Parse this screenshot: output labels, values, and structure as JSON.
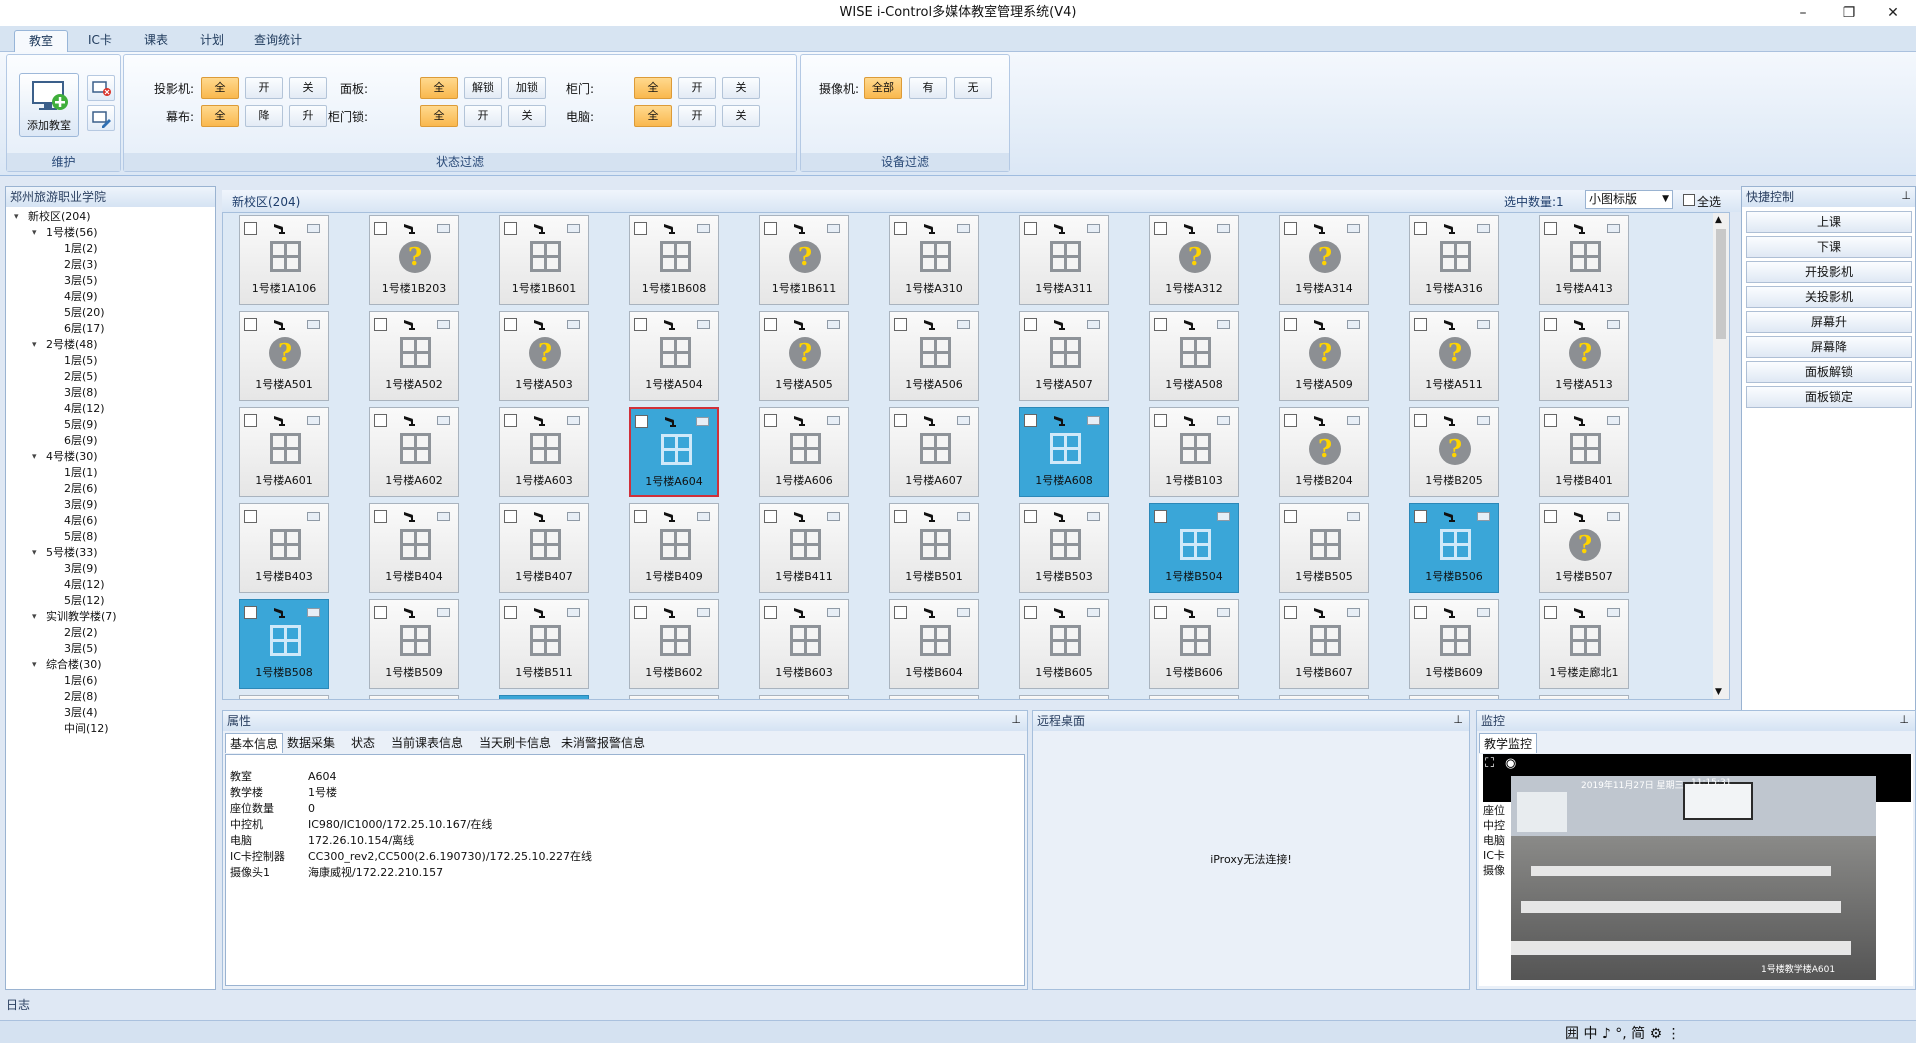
{
  "window": {
    "title": "WISE i-Control多媒体教室管理系统(V4)",
    "minimize_icon": "–",
    "restore_icon": "❐",
    "close_icon": "✕"
  },
  "menu": {
    "tabs": [
      "教室",
      "IC卡",
      "课表",
      "计划",
      "查询统计"
    ],
    "active": "教室"
  },
  "ribbon": {
    "maintain": {
      "label": "维护",
      "add_room": "添加教室"
    },
    "status_filter": {
      "label": "状态过滤",
      "projector": {
        "label": "投影机:",
        "options": [
          "全",
          "开",
          "关"
        ]
      },
      "screen": {
        "label": "幕布:",
        "options": [
          "全",
          "降",
          "升"
        ]
      },
      "panel": {
        "label": "面板:",
        "options": [
          "全",
          "解锁",
          "加锁"
        ]
      },
      "cabinet_lock": {
        "label": "柜门锁:",
        "options": [
          "全",
          "开",
          "关"
        ]
      },
      "door": {
        "label": "柜门:",
        "options": [
          "全",
          "开",
          "关"
        ]
      },
      "pc": {
        "label": "电脑:",
        "options": [
          "全",
          "开",
          "关"
        ]
      }
    },
    "device_filter": {
      "label": "设备过滤",
      "camera": {
        "label": "摄像机:",
        "options": [
          "全部",
          "有",
          "无"
        ]
      }
    }
  },
  "tree": {
    "title": "郑州旅游职业学院",
    "nodes": [
      {
        "t": "新校区(204)",
        "l": 0,
        "e": true
      },
      {
        "t": "1号楼(56)",
        "l": 1,
        "e": true
      },
      {
        "t": "1层(2)",
        "l": 2
      },
      {
        "t": "2层(3)",
        "l": 2
      },
      {
        "t": "3层(5)",
        "l": 2
      },
      {
        "t": "4层(9)",
        "l": 2
      },
      {
        "t": "5层(20)",
        "l": 2
      },
      {
        "t": "6层(17)",
        "l": 2
      },
      {
        "t": "2号楼(48)",
        "l": 1,
        "e": true
      },
      {
        "t": "1层(5)",
        "l": 2
      },
      {
        "t": "2层(5)",
        "l": 2
      },
      {
        "t": "3层(8)",
        "l": 2
      },
      {
        "t": "4层(12)",
        "l": 2
      },
      {
        "t": "5层(9)",
        "l": 2
      },
      {
        "t": "6层(9)",
        "l": 2
      },
      {
        "t": "4号楼(30)",
        "l": 1,
        "e": true
      },
      {
        "t": "1层(1)",
        "l": 2
      },
      {
        "t": "2层(6)",
        "l": 2
      },
      {
        "t": "3层(9)",
        "l": 2
      },
      {
        "t": "4层(6)",
        "l": 2
      },
      {
        "t": "5层(8)",
        "l": 2
      },
      {
        "t": "5号楼(33)",
        "l": 1,
        "e": true
      },
      {
        "t": "3层(9)",
        "l": 2
      },
      {
        "t": "4层(12)",
        "l": 2
      },
      {
        "t": "5层(12)",
        "l": 2
      },
      {
        "t": "实训教学楼(7)",
        "l": 1,
        "e": true
      },
      {
        "t": "2层(2)",
        "l": 2
      },
      {
        "t": "3层(5)",
        "l": 2
      },
      {
        "t": "综合楼(30)",
        "l": 1,
        "e": true
      },
      {
        "t": "1层(6)",
        "l": 2
      },
      {
        "t": "2层(8)",
        "l": 2
      },
      {
        "t": "3层(4)",
        "l": 2
      },
      {
        "t": "中间(12)",
        "l": 2
      }
    ]
  },
  "center": {
    "title": "新校区(204)",
    "selected_count": "选中数量:1",
    "view_mode": "小图标版",
    "select_all": "全选"
  },
  "rooms": [
    {
      "n": "1号楼1A106",
      "cam": true,
      "q": false
    },
    {
      "n": "1号楼1B203",
      "cam": true,
      "q": true
    },
    {
      "n": "1号楼1B601",
      "cam": true,
      "q": false
    },
    {
      "n": "1号楼1B608",
      "cam": true,
      "q": false
    },
    {
      "n": "1号楼1B611",
      "cam": true,
      "q": true
    },
    {
      "n": "1号楼A310",
      "cam": true,
      "q": false
    },
    {
      "n": "1号楼A311",
      "cam": true,
      "q": false
    },
    {
      "n": "1号楼A312",
      "cam": true,
      "q": true
    },
    {
      "n": "1号楼A314",
      "cam": true,
      "q": true
    },
    {
      "n": "1号楼A316",
      "cam": true,
      "q": false
    },
    {
      "n": "1号楼A413",
      "cam": true,
      "q": false
    },
    {
      "n": "1号楼A501",
      "cam": true,
      "q": true
    },
    {
      "n": "1号楼A502",
      "cam": true,
      "q": false
    },
    {
      "n": "1号楼A503",
      "cam": true,
      "q": true
    },
    {
      "n": "1号楼A504",
      "cam": true,
      "q": false
    },
    {
      "n": "1号楼A505",
      "cam": true,
      "q": true
    },
    {
      "n": "1号楼A506",
      "cam": true,
      "q": false
    },
    {
      "n": "1号楼A507",
      "cam": true,
      "q": false
    },
    {
      "n": "1号楼A508",
      "cam": true,
      "q": false
    },
    {
      "n": "1号楼A509",
      "cam": true,
      "q": true
    },
    {
      "n": "1号楼A511",
      "cam": true,
      "q": true
    },
    {
      "n": "1号楼A513",
      "cam": true,
      "q": true
    },
    {
      "n": "1号楼A601",
      "cam": true,
      "q": false
    },
    {
      "n": "1号楼A602",
      "cam": true,
      "q": false
    },
    {
      "n": "1号楼A603",
      "cam": true,
      "q": false
    },
    {
      "n": "1号楼A604",
      "cam": true,
      "q": false,
      "sel": true,
      "cur": true
    },
    {
      "n": "1号楼A606",
      "cam": true,
      "q": false
    },
    {
      "n": "1号楼A607",
      "cam": true,
      "q": false
    },
    {
      "n": "1号楼A608",
      "cam": true,
      "q": false,
      "sel": true
    },
    {
      "n": "1号楼B103",
      "cam": true,
      "q": false
    },
    {
      "n": "1号楼B204",
      "cam": true,
      "q": true
    },
    {
      "n": "1号楼B205",
      "cam": true,
      "q": true
    },
    {
      "n": "1号楼B401",
      "cam": true,
      "q": false
    },
    {
      "n": "1号楼B403",
      "cam": false,
      "q": false
    },
    {
      "n": "1号楼B404",
      "cam": true,
      "q": false
    },
    {
      "n": "1号楼B407",
      "cam": true,
      "q": false
    },
    {
      "n": "1号楼B409",
      "cam": true,
      "q": false
    },
    {
      "n": "1号楼B411",
      "cam": true,
      "q": false
    },
    {
      "n": "1号楼B501",
      "cam": true,
      "q": false
    },
    {
      "n": "1号楼B503",
      "cam": true,
      "q": false
    },
    {
      "n": "1号楼B504",
      "cam": false,
      "q": false,
      "sel": true
    },
    {
      "n": "1号楼B505",
      "cam": false,
      "q": false
    },
    {
      "n": "1号楼B506",
      "cam": true,
      "q": false,
      "sel": true
    },
    {
      "n": "1号楼B507",
      "cam": true,
      "q": true
    },
    {
      "n": "1号楼B508",
      "cam": true,
      "q": false,
      "sel": true
    },
    {
      "n": "1号楼B509",
      "cam": true,
      "q": false
    },
    {
      "n": "1号楼B511",
      "cam": true,
      "q": false
    },
    {
      "n": "1号楼B602",
      "cam": true,
      "q": false
    },
    {
      "n": "1号楼B603",
      "cam": true,
      "q": false
    },
    {
      "n": "1号楼B604",
      "cam": true,
      "q": false
    },
    {
      "n": "1号楼B605",
      "cam": true,
      "q": false
    },
    {
      "n": "1号楼B606",
      "cam": true,
      "q": false
    },
    {
      "n": "1号楼B607",
      "cam": true,
      "q": false
    },
    {
      "n": "1号楼B609",
      "cam": true,
      "q": false
    },
    {
      "n": "1号楼走廊北1",
      "cam": true,
      "q": false
    }
  ],
  "quick_control": {
    "title": "快捷控制",
    "buttons": [
      "上课",
      "下课",
      "开投影机",
      "关投影机",
      "屏幕升",
      "屏幕降",
      "面板解锁",
      "面板锁定"
    ]
  },
  "properties": {
    "title": "属性",
    "tabs": [
      "基本信息",
      "数据采集",
      "状态",
      "当前课表信息",
      "当天刷卡信息",
      "未消警报警信息"
    ],
    "rows": [
      {
        "k": "教室",
        "v": "A604"
      },
      {
        "k": "教学楼",
        "v": "1号楼"
      },
      {
        "k": "座位数量",
        "v": "0"
      },
      {
        "k": "中控机",
        "v": "IC980/IC1000/172.25.10.167/在线"
      },
      {
        "k": "电脑",
        "v": "172.26.10.154/离线"
      },
      {
        "k": "IC卡控制器",
        "v": "CC300_rev2,CC500(2.6.190730)/172.25.10.227在线"
      },
      {
        "k": "摄像头1",
        "v": "海康威视/172.22.210.157"
      }
    ]
  },
  "remote": {
    "title": "远程桌面",
    "message": "iProxy无法连接!"
  },
  "monitor": {
    "title": "监控",
    "tab": "教学监控",
    "bg_rows": [
      "教学",
      "座位",
      "中控",
      "电脑",
      "IC卡",
      "摄像"
    ],
    "cam_time": "11:15:31",
    "cam_date": "2019年11月27日 星期三",
    "cam_label": "1号楼教学楼A601"
  },
  "log": {
    "label": "日志"
  },
  "ime": {
    "text": "囲 中 ♪ °, 简 ⚙ ⋮"
  }
}
